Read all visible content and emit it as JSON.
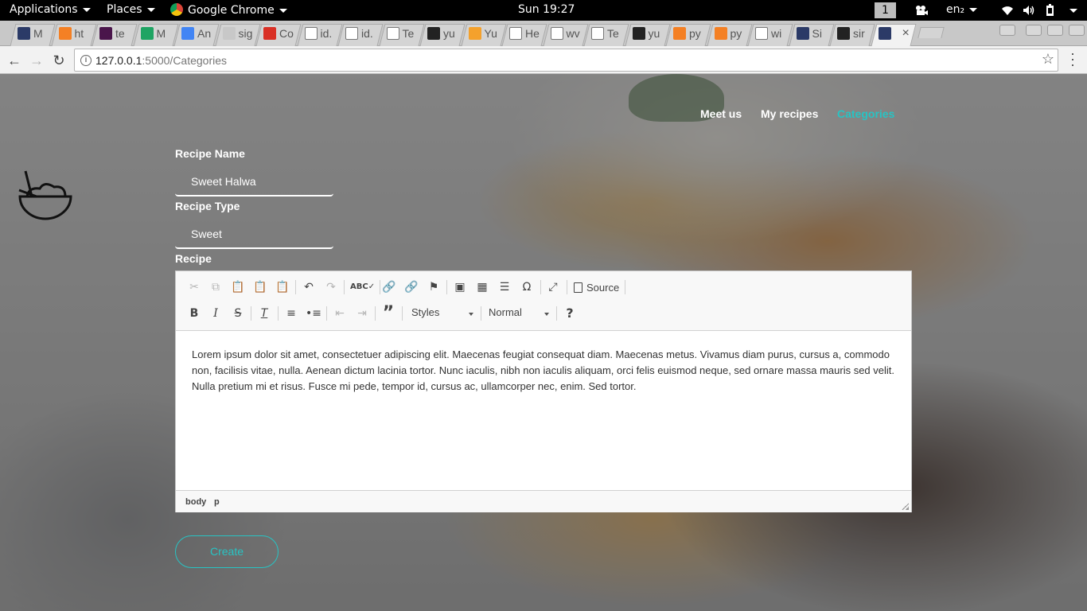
{
  "desktop": {
    "applications_label": "Applications",
    "places_label": "Places",
    "active_app_label": "Google Chrome",
    "clock": "Sun 19:27",
    "workspace_number": "1",
    "keyboard_layout": "en₂"
  },
  "browser": {
    "tabs": [
      {
        "title": "M",
        "favicon": "terminal-icon"
      },
      {
        "title": "ht",
        "favicon": "stackoverflow-icon"
      },
      {
        "title": "te",
        "favicon": "slack-icon"
      },
      {
        "title": "M",
        "favicon": "google-drive-icon"
      },
      {
        "title": "An",
        "favicon": "google-docs-icon"
      },
      {
        "title": "sig",
        "favicon": "hackerrank-icon"
      },
      {
        "title": "Co",
        "favicon": "gmail-icon"
      },
      {
        "title": "id.",
        "favicon": "document-icon"
      },
      {
        "title": "id.",
        "favicon": "document-icon"
      },
      {
        "title": "Te",
        "favicon": "document-icon"
      },
      {
        "title": "yu",
        "favicon": "github-icon"
      },
      {
        "title": "Yu",
        "favicon": "web-icon"
      },
      {
        "title": "He",
        "favicon": "document-icon"
      },
      {
        "title": "wv",
        "favicon": "document-icon"
      },
      {
        "title": "Te",
        "favicon": "document-icon"
      },
      {
        "title": "yu",
        "favicon": "github-icon"
      },
      {
        "title": "py",
        "favicon": "stackoverflow-icon"
      },
      {
        "title": "py",
        "favicon": "stackoverflow-icon"
      },
      {
        "title": "wi",
        "favicon": "document-icon"
      },
      {
        "title": "Si",
        "favicon": "terminal-icon"
      },
      {
        "title": "sir",
        "favicon": "github-icon"
      },
      {
        "title": "",
        "favicon": "terminal-icon",
        "active": true
      }
    ],
    "url_host": "127.0.0.1",
    "url_rest": ":5000/Categories"
  },
  "site": {
    "nav": [
      {
        "label": "Meet us"
      },
      {
        "label": "My recipes"
      },
      {
        "label": "Categories",
        "active": true
      }
    ],
    "accent_color": "#27c4c4"
  },
  "form": {
    "recipe_name_label": "Recipe Name",
    "recipe_name_value": "Sweet Halwa",
    "recipe_type_label": "Recipe Type",
    "recipe_type_value": "Sweet",
    "recipe_label": "Recipe",
    "create_button": "Create"
  },
  "editor": {
    "source_label": "Source",
    "styles_label": "Styles",
    "format_label": "Normal",
    "content": "Lorem ipsum dolor sit amet, consectetuer adipiscing elit. Maecenas feugiat consequat diam. Maecenas metus. Vivamus diam purus, cursus a, commodo non, facilisis vitae, nulla. Aenean dictum lacinia tortor. Nunc iaculis, nibh non iaculis aliquam, orci felis euismod neque, sed ornare massa mauris sed velit. Nulla pretium mi et risus. Fusce mi pede, tempor id, cursus ac, ullamcorper nec, enim. Sed tortor.",
    "path": [
      "body",
      "p"
    ]
  }
}
